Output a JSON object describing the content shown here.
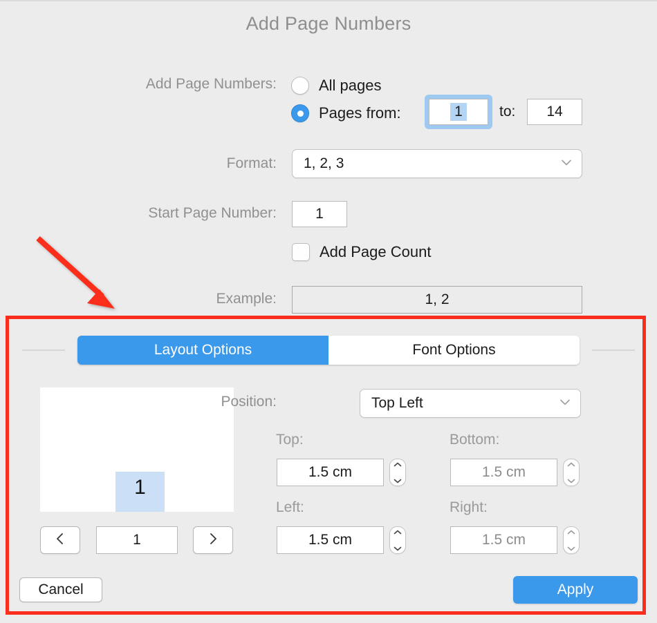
{
  "dialog": {
    "title": "Add Page Numbers"
  },
  "form": {
    "add_page_numbers_label": "Add Page Numbers:",
    "radio_all_pages": "All pages",
    "radio_pages_from": "Pages from:",
    "pages_from_value": "1",
    "to_label": "to:",
    "pages_to_value": "14",
    "format_label": "Format:",
    "format_value": "1, 2, 3",
    "start_page_number_label": "Start Page Number:",
    "start_page_number_value": "1",
    "add_page_count_label": "Add Page Count",
    "example_label": "Example:",
    "example_value": "1, 2"
  },
  "tabs": [
    {
      "label": "Layout Options",
      "active": true
    },
    {
      "label": "Font Options",
      "active": false
    }
  ],
  "preview": {
    "page_number_marker": "1",
    "page_field_value": "1",
    "prev_icon": "chevron-left-icon",
    "next_icon": "chevron-right-icon"
  },
  "layout_options": {
    "position_label": "Position:",
    "position_value": "Top Left",
    "top_label": "Top:",
    "top_value": "1.5 cm",
    "bottom_label": "Bottom:",
    "bottom_value": "1.5 cm",
    "left_label": "Left:",
    "left_value": "1.5 cm",
    "right_label": "Right:",
    "right_value": "1.5 cm"
  },
  "footer": {
    "cancel_label": "Cancel",
    "apply_label": "Apply"
  },
  "annotation": {
    "highlight_color": "#fb2d1c",
    "arrow_color": "#fb2d1c"
  },
  "colors": {
    "accent": "#3b99ec",
    "background": "#ececec",
    "label": "#909093",
    "title": "#8e8e90",
    "selection": "#b5d4f4",
    "preview_marker": "#cbdff7"
  }
}
